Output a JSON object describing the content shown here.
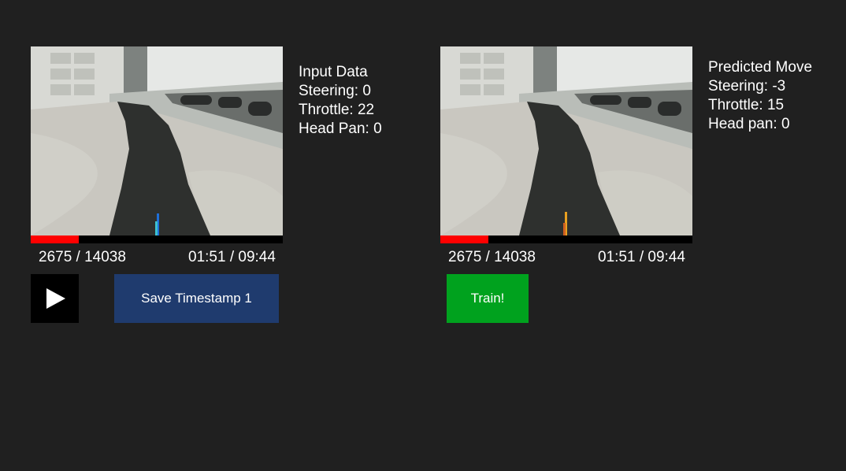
{
  "left_panel": {
    "title": "Input Data",
    "steering": "Steering: 0",
    "throttle": "Throttle: 22",
    "head_pan": "Head Pan: 0",
    "frame_counter": "2675 / 14038",
    "time_counter": "01:51 / 09:44",
    "progress_fraction": 0.19,
    "play_icon": "play-icon",
    "save_label": "Save Timestamp 1"
  },
  "right_panel": {
    "title": "Predicted Move",
    "steering": "Steering: -3",
    "throttle": "Throttle: 15",
    "head_pan": "Head pan: 0",
    "frame_counter": "2675 / 14038",
    "time_counter": "01:51 / 09:44",
    "progress_fraction": 0.19,
    "train_label": "Train!"
  },
  "colors": {
    "background": "#202020",
    "progress_fill": "#ff0000",
    "progress_track": "#000000",
    "save_button": "#1f3b6e",
    "train_button": "#00a21e",
    "play_button": "#000000",
    "input_marker": "#1e6fd9",
    "predicted_marker": "#e8a020"
  }
}
